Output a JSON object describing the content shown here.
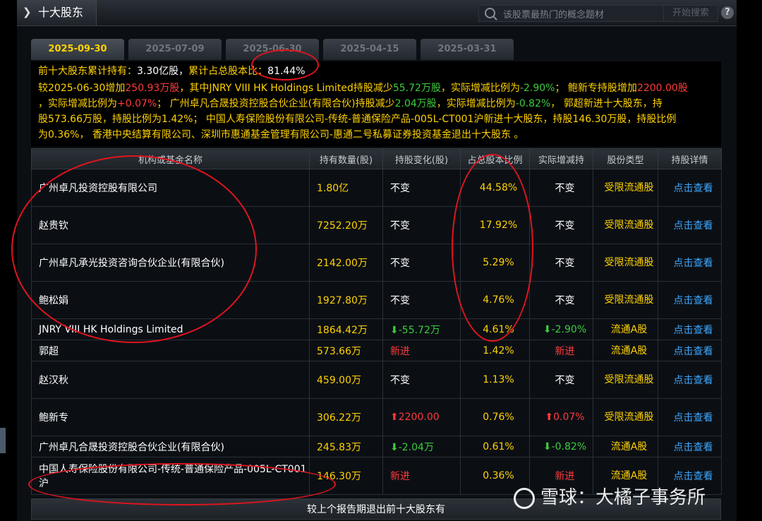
{
  "window": {
    "title": "十大股东",
    "search_placeholder": "该股票最热门的概念题材",
    "search_button": "开始搜索",
    "help_label": "?"
  },
  "tabs": [
    {
      "label": "2025-09-30",
      "active": true
    },
    {
      "label": "2025-07-09",
      "active": false
    },
    {
      "label": "2025-06-30",
      "active": false
    },
    {
      "label": "2025-04-15",
      "active": false
    },
    {
      "label": "2025-03-31",
      "active": false
    }
  ],
  "summary": {
    "l1_a": "前十大股东累计持有：",
    "l1_b": "3.30亿股，",
    "l1_c": "累计占总股本比：",
    "l1_d": "81.44%",
    "l2_a": "较2025-06-30增加",
    "l2_b": "250.93万股",
    "l2_c": "，其中JNRY VIII HK Holdings Limited持股减少",
    "l2_d": "55.72万股",
    "l2_e": "，实际增减比例为",
    "l2_f": "-2.90%",
    "l2_g": "；  鲍新专持股增加",
    "l2_h": "2200.00股",
    "l3_a": "，实际增减比例为",
    "l3_b": "+0.07%",
    "l3_c": "；  广州卓凡合晟投资控股合伙企业(有限合伙)持股减少",
    "l3_d": "2.04万股",
    "l3_e": "，实际增减比例为",
    "l3_f": "-0.82%",
    "l3_g": "，  郭超新进十大股东，持",
    "l4": "股573.66万股，持股比例为1.42%；  中国人寿保险股份有限公司-传统-普通保险产品-005L-CT001沪新进十大股东，持股146.30万股，持股比例",
    "l5": "为0.36%，  香港中央结算有限公司、深圳市惠通基金管理有限公司-惠通二号私募证券投资基金退出十大股东 。"
  },
  "table": {
    "headers": [
      "机构或基金名称",
      "持有数量(股)",
      "持股变化(股)",
      "占总股本比例",
      "实际增减持",
      "股份类型",
      "持股详情"
    ],
    "rows": [
      {
        "name": "广州卓凡投资控股有限公司",
        "qty": "1.80亿",
        "chg": "不变",
        "chg_dir": "none",
        "pct": "44.58%",
        "act": "不变",
        "act_dir": "none",
        "type": "受限流通股",
        "detail": "点击查看",
        "tall": true
      },
      {
        "name": "赵贵钦",
        "qty": "7252.20万",
        "chg": "不变",
        "chg_dir": "none",
        "pct": "17.92%",
        "act": "不变",
        "act_dir": "none",
        "type": "受限流通股",
        "detail": "点击查看",
        "tall": true
      },
      {
        "name": "广州卓凡承光投资咨询合伙企业(有限合伙)",
        "qty": "2142.00万",
        "chg": "不变",
        "chg_dir": "none",
        "pct": "5.29%",
        "act": "不变",
        "act_dir": "none",
        "type": "受限流通股",
        "detail": "点击查看",
        "tall": true
      },
      {
        "name": "鲍松娟",
        "qty": "1927.80万",
        "chg": "不变",
        "chg_dir": "none",
        "pct": "4.76%",
        "act": "不变",
        "act_dir": "none",
        "type": "受限流通股",
        "detail": "点击查看",
        "tall": true
      },
      {
        "name": "JNRY VIII HK Holdings Limited",
        "qty": "1864.42万",
        "chg": "-55.72万",
        "chg_dir": "down",
        "pct": "4.61%",
        "act": "-2.90%",
        "act_dir": "down",
        "type": "流通A股",
        "detail": "点击查看",
        "tall": false
      },
      {
        "name": "郭超",
        "qty": "573.66万",
        "chg": "新进",
        "chg_dir": "new",
        "pct": "1.42%",
        "act": "新进",
        "act_dir": "new",
        "type": "流通A股",
        "detail": "点击查看",
        "tall": false
      },
      {
        "name": "赵汉秋",
        "qty": "459.00万",
        "chg": "不变",
        "chg_dir": "none",
        "pct": "1.13%",
        "act": "不变",
        "act_dir": "none",
        "type": "受限流通股",
        "detail": "点击查看",
        "tall": true
      },
      {
        "name": "鲍新专",
        "qty": "306.22万",
        "chg": "2200.00",
        "chg_dir": "up",
        "pct": "0.76%",
        "act": "0.07%",
        "act_dir": "up",
        "type": "受限流通股",
        "detail": "点击查看",
        "tall": true
      },
      {
        "name": "广州卓凡合晟投资控股合伙企业(有限合伙)",
        "qty": "245.83万",
        "chg": "-2.04万",
        "chg_dir": "down",
        "pct": "0.61%",
        "act": "-0.82%",
        "act_dir": "down",
        "type": "流通A股",
        "detail": "点击查看",
        "tall": false
      },
      {
        "name": "中国人寿保险股份有限公司-传统-普通保险产品-005L-CT001沪",
        "qty": "146.30万",
        "chg": "新进",
        "chg_dir": "new",
        "pct": "0.36%",
        "act": "新进",
        "act_dir": "new",
        "type": "流通A股",
        "detail": "点击查看",
        "tall": true
      }
    ],
    "footer": "较上个报告期退出前十大股东有"
  },
  "watermark": "雪球：大橘子事务所",
  "colors": {
    "yellow": "#ffd200",
    "red": "#ff3b3b",
    "green": "#3ccc3c",
    "link": "#3ea7ff",
    "annotation": "#e0141e"
  }
}
